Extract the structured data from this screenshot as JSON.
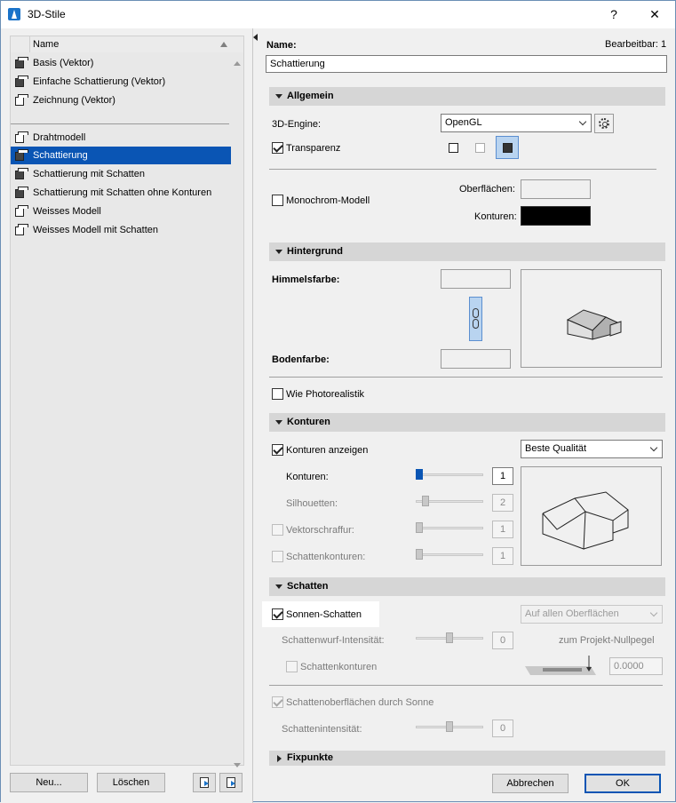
{
  "window": {
    "title": "3D-Stile",
    "help_glyph": "?",
    "close_glyph": "✕"
  },
  "list": {
    "header": "Name",
    "group1": [
      {
        "label": "Basis (Vektor)",
        "icon": "style-cube-icon"
      },
      {
        "label": "Einfache Schattierung (Vektor)",
        "icon": "style-cube-icon"
      },
      {
        "label": "Zeichnung (Vektor)",
        "icon": "style-cube-icon"
      }
    ],
    "group2": [
      {
        "label": "Drahtmodell",
        "icon": "wireframe-cube-icon"
      },
      {
        "label": "Schattierung",
        "icon": "shaded-cube-icon",
        "selected": true
      },
      {
        "label": "Schattierung mit Schatten",
        "icon": "shaded-cube-icon"
      },
      {
        "label": "Schattierung mit Schatten ohne Konturen",
        "icon": "shaded-cube-icon"
      },
      {
        "label": "Weisses Modell",
        "icon": "white-cube-icon"
      },
      {
        "label": "Weisses Modell mit Schatten",
        "icon": "white-cube-icon"
      }
    ],
    "new_button": "Neu...",
    "delete_button": "Löschen"
  },
  "form": {
    "name_label": "Name:",
    "editable_label": "Bearbeitbar: 1",
    "name_value": "Schattierung",
    "allgemein": {
      "title": "Allgemein",
      "engine_label": "3D-Engine:",
      "engine_value": "OpenGL",
      "transparency_label": "Transparenz",
      "monochrome_label": "Monochrom-Modell",
      "surfaces_label": "Oberflächen:",
      "contours_label": "Konturen:"
    },
    "hintergrund": {
      "title": "Hintergrund",
      "sky_label": "Himmelsfarbe:",
      "ground_label": "Bodenfarbe:",
      "photoreal_label": "Wie Photorealistik"
    },
    "konturen": {
      "title": "Konturen",
      "show_label": "Konturen anzeigen",
      "quality_value": "Beste Qualität",
      "contours_label": "Konturen:",
      "contours_value": "1",
      "silhouettes_label": "Silhouetten:",
      "silhouettes_value": "2",
      "vector_hatch_label": "Vektorschraffur:",
      "vector_hatch_value": "1",
      "shadow_contours_label": "Schattenkonturen:",
      "shadow_contours_value": "1"
    },
    "schatten": {
      "title": "Schatten",
      "sun_shadow_label": "Sonnen-Schatten",
      "surfaces_select": "Auf allen Oberflächen",
      "intensity_label": "Schattenwurf-Intensität:",
      "intensity_value": "0",
      "zero_level_label": "zum Projekt-Nullpegel",
      "shadow_contours_label": "Schattenkonturen",
      "level_value": "0.0000",
      "sun_surfaces_label": "Schattenoberflächen durch Sonne",
      "shadow_intensity_label": "Schattenintensität:",
      "shadow_intensity_value": "0"
    },
    "fixpunkte": {
      "title": "Fixpunkte"
    },
    "cancel_button": "Abbrechen",
    "ok_button": "OK"
  },
  "colors": {
    "selection": "#0a55b4",
    "section_header": "#d6d6d6",
    "contour_color": "#000000"
  }
}
